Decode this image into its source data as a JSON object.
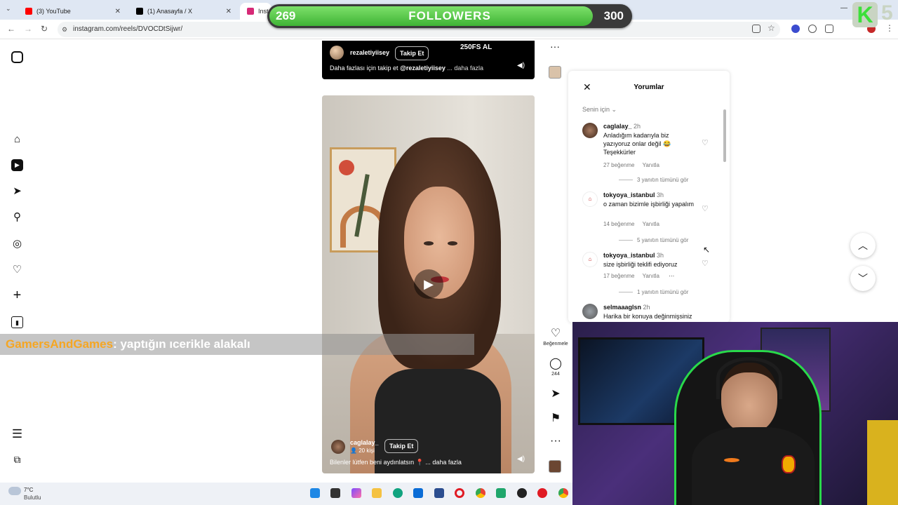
{
  "browser": {
    "tabs": [
      {
        "label": "(3) YouTube",
        "close": "✕",
        "color": "#ff0000"
      },
      {
        "label": "(1) Anasayfa / X",
        "close": "✕",
        "color": "#000000"
      },
      {
        "label": "Instagram",
        "close": "",
        "color": "#d62976"
      }
    ],
    "url": "instagram.com/reels/DVOCDtSijwr/"
  },
  "overlay": {
    "followers_current": "269",
    "followers_label": "FOLLOWERS",
    "followers_goal": "300",
    "followers_progress": 0.897,
    "logo_letter": "K",
    "logo_number": "5"
  },
  "reel_top": {
    "username": "rezaletiyiisey",
    "follow_label": "Takip Et",
    "banner_text": "250FS AL",
    "caption": "Daha fazlası için takip et",
    "mention": "@rezaletiyiisey",
    "more": "... daha fazla"
  },
  "reel": {
    "username": "caglalay_",
    "follow_label": "Takip Et",
    "people_count": "20 kişi",
    "caption": "Bilenler lütfen beni aydınlatsın",
    "more": "... daha fazla"
  },
  "actions": {
    "like_label": "Beğenmele",
    "comment_count": "244"
  },
  "comments_panel": {
    "title": "Yorumlar",
    "filter": "Senin için",
    "comments": [
      {
        "user": "caglalay_",
        "time": "2h",
        "text": "Anladığım kadarıyla biz yazıyoruz onlar değil 😂 Teşekkürler",
        "likes": "27 beğenme",
        "reply": "Yanıtla",
        "view_replies": "3 yanıtın tümünü gör"
      },
      {
        "user": "tokyoya_istanbul",
        "time": "3h",
        "text": "o zaman bizimle işbirliği yapalım",
        "likes": "14 beğenme",
        "reply": "Yanıtla",
        "view_replies": "5 yanıtın tümünü gör"
      },
      {
        "user": "tokyoya_istanbul",
        "time": "3h",
        "text": "size işbirliği teklifi ediyoruz",
        "likes": "17 beğenme",
        "reply": "Yanıtla",
        "view_replies": "1 yanıtın tümünü gör"
      },
      {
        "user": "selmaaaglsn",
        "time": "2h",
        "text": "Harika bir konuya değinmişsiniz",
        "likes": "",
        "reply": "",
        "view_replies": ""
      }
    ]
  },
  "chat": {
    "user": "GamersAndGames",
    "message": ": yaptığın ıcerikle alakalı"
  },
  "weather": {
    "temp": "7°C",
    "condition": "Bulutlu"
  }
}
